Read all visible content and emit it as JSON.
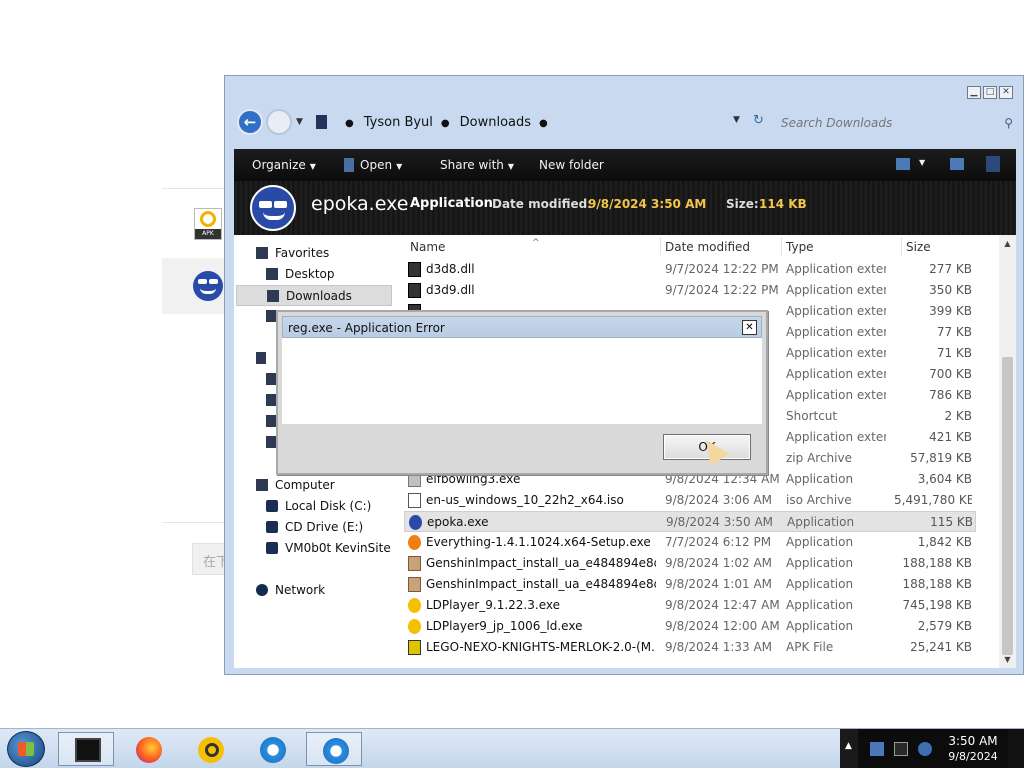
{
  "background_app": {
    "input_placeholder": "在下",
    "apk_badge": "APK"
  },
  "explorer": {
    "breadcrumb": [
      "Tyson Byul",
      "Downloads"
    ],
    "search_placeholder": "Search Downloads",
    "toolbar": {
      "organize": "Organize",
      "open": "Open",
      "share_with": "Share with",
      "new_folder": "New folder"
    },
    "details": {
      "name": "epoka.exe",
      "type": "Application",
      "date_modified_label": "Date modified:",
      "date_modified": "9/8/2024 3:50 AM",
      "size_label": "Size:",
      "size": "114 KB"
    },
    "nav": {
      "favorites": "Favorites",
      "desktop": "Desktop",
      "downloads": "Downloads",
      "computer": "Computer",
      "local_disk": "Local Disk (C:)",
      "cd_drive": "CD Drive (E:)",
      "vm_site": "VM0b0t KevinSite",
      "network": "Network"
    },
    "columns": {
      "name": "Name",
      "date": "Date modified",
      "type": "Type",
      "size": "Size"
    },
    "files": [
      {
        "name": "d3d8.dll",
        "date": "9/7/2024 12:22 PM",
        "type": "Application extens...",
        "size": "277 KB",
        "icon": "dll-icon"
      },
      {
        "name": "d3d9.dll",
        "date": "9/7/2024 12:22 PM",
        "type": "Application extens...",
        "size": "350 KB",
        "icon": "dll-icon"
      },
      {
        "name": "",
        "date": "",
        "type": "Application extens...",
        "size": "399 KB",
        "icon": "dll-icon"
      },
      {
        "name": "",
        "date": "",
        "type": "Application extens...",
        "size": "77 KB",
        "icon": "dll-icon"
      },
      {
        "name": "",
        "date": "",
        "type": "Application extens...",
        "size": "71 KB",
        "icon": "dll-icon"
      },
      {
        "name": "",
        "date": "",
        "type": "Application extens...",
        "size": "700 KB",
        "icon": "dll-icon"
      },
      {
        "name": "",
        "date": "",
        "type": "Application extens...",
        "size": "786 KB",
        "icon": "dll-icon"
      },
      {
        "name": "",
        "date": "",
        "type": "Shortcut",
        "size": "2 KB",
        "icon": "shortcut-icon"
      },
      {
        "name": "",
        "date": "",
        "type": "Application extens...",
        "size": "421 KB",
        "icon": "dll-icon"
      },
      {
        "name": "",
        "date": "",
        "type": "zip Archive",
        "size": "57,819 KB",
        "icon": "zip-icon"
      },
      {
        "name": "elfbowling3.exe",
        "date": "9/8/2024 12:34 AM",
        "type": "Application",
        "size": "3,604 KB",
        "icon": "exe-icon"
      },
      {
        "name": "en-us_windows_10_22h2_x64.iso",
        "date": "9/8/2024 3:06 AM",
        "type": "iso Archive",
        "size": "5,491,780 KB",
        "icon": "iso-icon"
      },
      {
        "name": "epoka.exe",
        "date": "9/8/2024 3:50 AM",
        "type": "Application",
        "size": "115 KB",
        "icon": "epoka-icon"
      },
      {
        "name": "Everything-1.4.1.1024.x64-Setup.exe",
        "date": "7/7/2024 6:12 PM",
        "type": "Application",
        "size": "1,842 KB",
        "icon": "everything-icon"
      },
      {
        "name": "GenshinImpact_install_ua_e484894e8d0f(...",
        "date": "9/8/2024 1:02 AM",
        "type": "Application",
        "size": "188,188 KB",
        "icon": "genshin-icon"
      },
      {
        "name": "GenshinImpact_install_ua_e484894e8d0f...",
        "date": "9/8/2024 1:01 AM",
        "type": "Application",
        "size": "188,188 KB",
        "icon": "genshin-icon"
      },
      {
        "name": "LDPlayer_9.1.22.3.exe",
        "date": "9/8/2024 12:47 AM",
        "type": "Application",
        "size": "745,198 KB",
        "icon": "ldplayer-icon"
      },
      {
        "name": "LDPlayer9_jp_1006_ld.exe",
        "date": "9/8/2024 12:00 AM",
        "type": "Application",
        "size": "2,579 KB",
        "icon": "ldplayer-icon"
      },
      {
        "name": "LEGO-NEXO-KNIGHTS-MERLOK-2.0-(M...",
        "date": "9/8/2024 1:33 AM",
        "type": "APK File",
        "size": "25,241 KB",
        "icon": "lego-icon"
      }
    ],
    "selected_index": 12
  },
  "dialog": {
    "title": "reg.exe - Application Error",
    "ok": "OK"
  },
  "taskbar": {
    "time": "3:50 AM",
    "date": "9/8/2024"
  }
}
